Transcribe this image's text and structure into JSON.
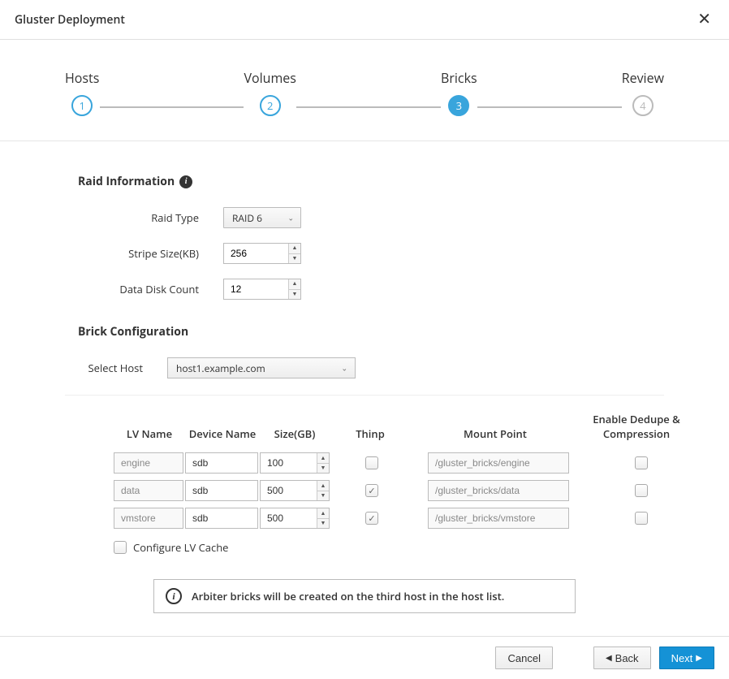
{
  "dialog": {
    "title": "Gluster Deployment"
  },
  "steps": [
    {
      "label": "Hosts",
      "num": "1"
    },
    {
      "label": "Volumes",
      "num": "2"
    },
    {
      "label": "Bricks",
      "num": "3"
    },
    {
      "label": "Review",
      "num": "4"
    }
  ],
  "raid": {
    "section_title": "Raid Information",
    "type_label": "Raid Type",
    "type_value": "RAID 6",
    "stripe_label": "Stripe Size(KB)",
    "stripe_value": "256",
    "disk_label": "Data Disk Count",
    "disk_value": "12"
  },
  "brickcfg": {
    "section_title": "Brick Configuration",
    "host_label": "Select Host",
    "host_value": "host1.example.com"
  },
  "columns": {
    "lv": "LV Name",
    "dev": "Device Name",
    "size": "Size(GB)",
    "thinp": "Thinp",
    "mount": "Mount Point",
    "dedupe": "Enable Dedupe & Compression"
  },
  "rows": [
    {
      "lv": "engine",
      "dev": "sdb",
      "size": "100",
      "thinp": false,
      "mount": "/gluster_bricks/engine",
      "dedupe": false
    },
    {
      "lv": "data",
      "dev": "sdb",
      "size": "500",
      "thinp": true,
      "mount": "/gluster_bricks/data",
      "dedupe": false
    },
    {
      "lv": "vmstore",
      "dev": "sdb",
      "size": "500",
      "thinp": true,
      "mount": "/gluster_bricks/vmstore",
      "dedupe": false
    }
  ],
  "configure_lv_label": "Configure LV Cache",
  "alert_text": "Arbiter bricks will be created on the third host in the host list.",
  "footer": {
    "cancel": "Cancel",
    "back": "Back",
    "next": "Next"
  }
}
